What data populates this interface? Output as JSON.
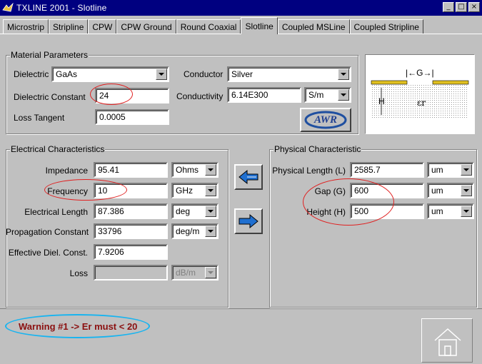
{
  "window": {
    "title": "TXLINE 2001 - Slotline",
    "buttons": [
      "_",
      "□",
      "×"
    ]
  },
  "tabs": [
    {
      "label": "Microstrip"
    },
    {
      "label": "Stripline"
    },
    {
      "label": "CPW"
    },
    {
      "label": "CPW Ground"
    },
    {
      "label": "Round Coaxial"
    },
    {
      "label": "Slotline"
    },
    {
      "label": "Coupled MSLine"
    },
    {
      "label": "Coupled Stripline"
    }
  ],
  "active_tab": "Slotline",
  "material": {
    "group_label": "Material Parameters",
    "dielectric_label": "Dielectric",
    "dielectric_value": "GaAs",
    "dielectric_constant_label": "Dielectric Constant",
    "dielectric_constant_value": "24",
    "loss_tangent_label": "Loss Tangent",
    "loss_tangent_value": "0.0005",
    "conductor_label": "Conductor",
    "conductor_value": "Silver",
    "conductivity_label": "Conductivity",
    "conductivity_value": "6.14E300",
    "conductivity_unit": "S/m",
    "logo_text": "AWR"
  },
  "diagram": {
    "gap_label": "|←G→|",
    "height_label": "H",
    "eps_label": "εr"
  },
  "electrical": {
    "group_label": "Electrical Characteristics",
    "rows": [
      {
        "label": "Impedance",
        "value": "95.41",
        "unit": "Ohms",
        "disabled": false
      },
      {
        "label": "Frequency",
        "value": "10",
        "unit": "GHz",
        "disabled": false
      },
      {
        "label": "Electrical Length",
        "value": "87.386",
        "unit": "deg",
        "disabled": false
      },
      {
        "label": "Propagation Constant",
        "value": "33796",
        "unit": "deg/m",
        "disabled": false
      },
      {
        "label": "Effective Diel. Const.",
        "value": "7.9206",
        "unit": "",
        "disabled": false
      },
      {
        "label": "Loss",
        "value": "",
        "unit": "dB/m",
        "disabled": true
      }
    ]
  },
  "physical": {
    "group_label": "Physical Characteristic",
    "rows": [
      {
        "label": "Physical Length (L)",
        "value": "2585.7",
        "unit": "um"
      },
      {
        "label": "Gap (G)",
        "value": "600",
        "unit": "um"
      },
      {
        "label": "Height (H)",
        "value": "500",
        "unit": "um"
      }
    ]
  },
  "status": {
    "warning": "Warning #1 -> Er must < 20"
  },
  "colors": {
    "titlebar": "#000080",
    "annotation_red": "#e02020",
    "annotation_blue": "#18b4f0",
    "warning_text": "#8b1010",
    "arrow_blue": "#1f6fd0"
  }
}
